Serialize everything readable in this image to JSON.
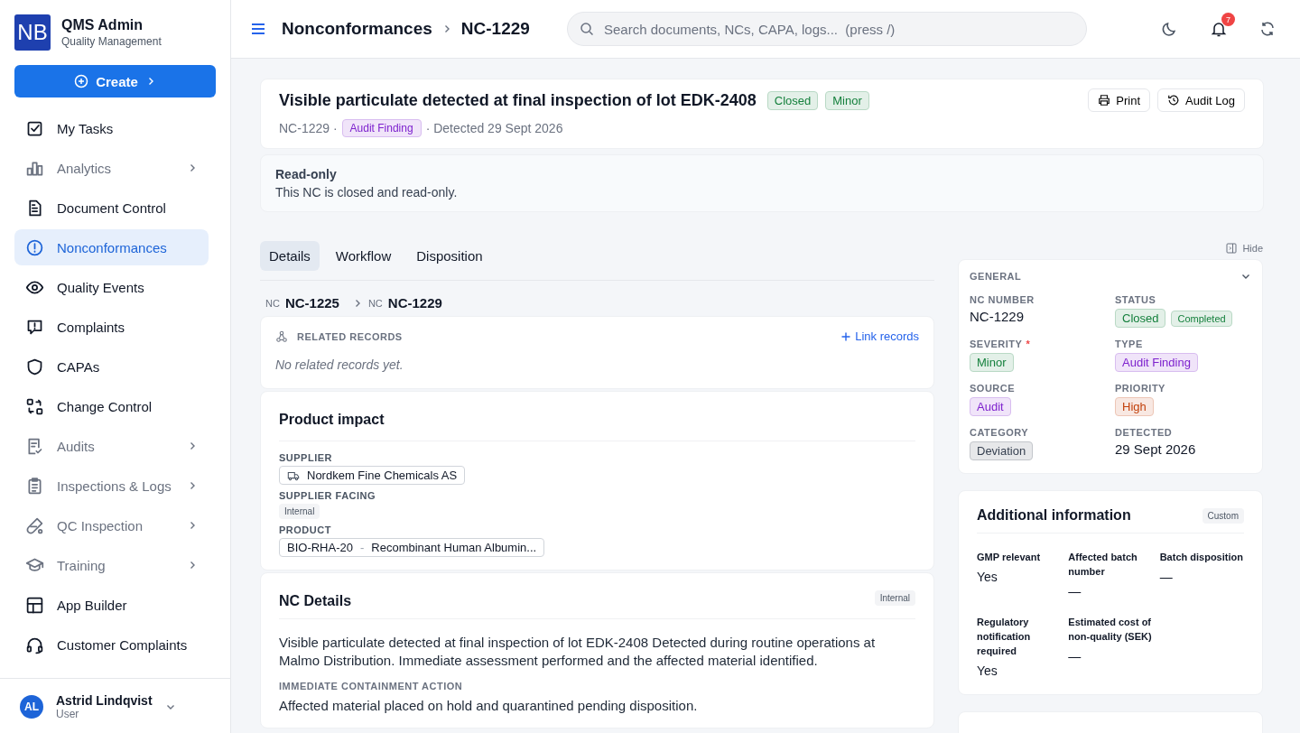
{
  "app": {
    "logo": "NB",
    "name": "QMS Admin",
    "subtitle": "Quality Management"
  },
  "create_button": {
    "label": "Create"
  },
  "sidebar": {
    "items": [
      {
        "label": "My Tasks",
        "kind": "check",
        "has_children": false,
        "selected": false
      },
      {
        "label": "Analytics",
        "kind": "chart",
        "has_children": true,
        "selected": false
      },
      {
        "label": "Document Control",
        "kind": "doc",
        "has_children": false,
        "selected": false
      },
      {
        "label": "Nonconformances",
        "kind": "alert",
        "has_children": false,
        "selected": true
      },
      {
        "label": "Quality Events",
        "kind": "eye",
        "has_children": false,
        "selected": false
      },
      {
        "label": "Complaints",
        "kind": "bubble",
        "has_children": false,
        "selected": false
      },
      {
        "label": "CAPAs",
        "kind": "shield",
        "has_children": false,
        "selected": false
      },
      {
        "label": "Change Control",
        "kind": "swap",
        "has_children": false,
        "selected": false
      },
      {
        "label": "Audits",
        "kind": "clipcheck",
        "has_children": true,
        "selected": false
      },
      {
        "label": "Inspections & Logs",
        "kind": "clipboard",
        "has_children": true,
        "selected": false
      },
      {
        "label": "QC Inspection",
        "kind": "tube",
        "has_children": true,
        "selected": false
      },
      {
        "label": "Training",
        "kind": "cap",
        "has_children": true,
        "selected": false
      },
      {
        "label": "App Builder",
        "kind": "grid",
        "has_children": false,
        "selected": false
      },
      {
        "label": "Customer Complaints",
        "kind": "headset",
        "has_children": false,
        "selected": false
      }
    ]
  },
  "user": {
    "initials": "AL",
    "name": "Astrid Lindqvist",
    "role": "User"
  },
  "topbar": {
    "breadcrumb": [
      "Nonconformances",
      "NC-1229"
    ],
    "search": {
      "placeholder": "Search documents, NCs, CAPA, logs...  (press /)"
    },
    "notifications": "7"
  },
  "header": {
    "title": "Visible particulate detected at final inspection of lot EDK-2408",
    "badges": [
      {
        "label": "Closed",
        "color": "#15803d"
      },
      {
        "label": "Minor",
        "color": "#15803d"
      }
    ],
    "meta_prefix": "NC-1229 ·",
    "type_badge": {
      "label": "Audit Finding",
      "color": "#7e22ce"
    },
    "meta_suffix": "· Detected 29 Sept 2026",
    "actions": [
      {
        "label": "Print"
      },
      {
        "label": "Audit Log"
      }
    ]
  },
  "notice": {
    "title": "Read-only",
    "text": "This NC is closed and read-only."
  },
  "tabs": [
    {
      "label": "Details",
      "selected": true
    },
    {
      "label": "Workflow",
      "selected": false
    },
    {
      "label": "Disposition",
      "selected": false
    }
  ],
  "hide_button": {
    "label": "Hide"
  },
  "record_trail": [
    {
      "prefix": "NC",
      "label": "NC-1225"
    },
    {
      "prefix": "NC",
      "label": "NC-1229"
    }
  ],
  "related": {
    "title": "RELATED RECORDS",
    "link": "Link records",
    "empty": "No related records yet."
  },
  "product_impact": {
    "title": "Product impact",
    "fields": [
      {
        "label": "SUPPLIER",
        "kind": "chip",
        "value": "Nordkem Fine Chemicals AS"
      },
      {
        "label": "SUPPLIER FACING",
        "kind": "tag",
        "value": "Internal"
      },
      {
        "label": "PRODUCT",
        "kind": "product",
        "code": "BIO-RHA-20",
        "separator": "-",
        "value": "Recombinant Human Albumin..."
      }
    ]
  },
  "nc_details": {
    "title": "NC Details",
    "tag": "Internal",
    "description": "Visible particulate detected at final inspection of lot EDK-2408 Detected during routine operations at Malmo Distribution. Immediate assessment performed and the affected material identified.",
    "sections": [
      {
        "label": "IMMEDIATE CONTAINMENT ACTION",
        "text": "Affected material placed on hold and quarantined pending disposition."
      }
    ]
  },
  "general": {
    "title": "GENERAL",
    "expanded": true,
    "fields": [
      {
        "label": "NC NUMBER",
        "kind": "text",
        "value": "NC-1229"
      },
      {
        "label": "STATUS",
        "kind": "badges",
        "badges": [
          {
            "label": "Closed",
            "color": "#15803d"
          },
          {
            "label": "Completed",
            "color": "#15803d"
          }
        ]
      },
      {
        "label": "SEVERITY",
        "required_mark": "*",
        "kind": "badges",
        "badges": [
          {
            "label": "Minor",
            "color": "#15803d"
          }
        ]
      },
      {
        "label": "TYPE",
        "kind": "badges",
        "badges": [
          {
            "label": "Audit Finding",
            "color": "#7e22ce"
          }
        ]
      },
      {
        "label": "SOURCE",
        "kind": "badges",
        "badges": [
          {
            "label": "Audit",
            "color": "#7e22ce"
          }
        ]
      },
      {
        "label": "PRIORITY",
        "kind": "badges",
        "badges": [
          {
            "label": "High",
            "color": "#c2410c"
          }
        ]
      },
      {
        "label": "CATEGORY",
        "kind": "badges",
        "badges": [
          {
            "label": "Deviation",
            "color": "#374151"
          }
        ]
      },
      {
        "label": "DETECTED",
        "kind": "text",
        "value": "29 Sept 2026"
      }
    ]
  },
  "additional": {
    "title": "Additional information",
    "tag": "Custom",
    "fields": [
      {
        "label": "GMP relevant",
        "value": "Yes"
      },
      {
        "label": "Affected batch number",
        "value": "—"
      },
      {
        "label": "Batch disposition",
        "value": "—"
      },
      {
        "label": "Regulatory notification required",
        "value": "Yes"
      },
      {
        "label": "Estimated cost of non-quality (SEK)",
        "value": "—"
      }
    ]
  }
}
